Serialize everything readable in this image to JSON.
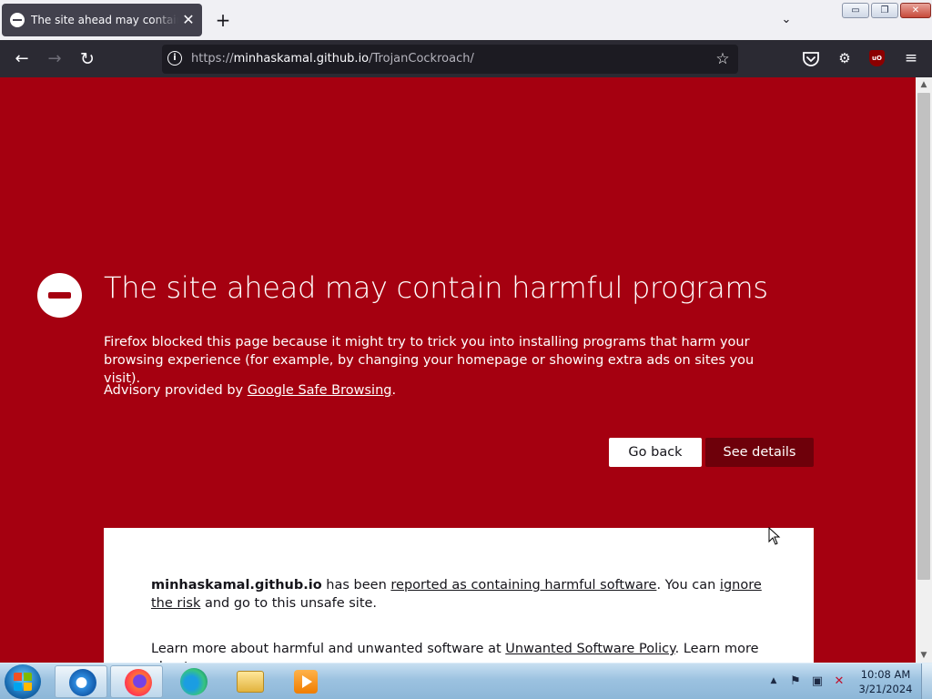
{
  "browser": {
    "tab": {
      "title": "The site ahead may contain harmful programs",
      "close_glyph": "✕",
      "icon": "blocked-icon"
    },
    "new_tab_glyph": "+",
    "tab_list_glyph": "⌄",
    "window_controls": {
      "minimize": "▭",
      "restore": "❐",
      "close": "✕"
    },
    "nav": {
      "back_glyph": "←",
      "forward_glyph": "→",
      "reload_glyph": "↻"
    },
    "url": {
      "scheme": "https://",
      "host": "minhaskamal.github.io",
      "path": "/TrojanCockroach/",
      "info_glyph": "i"
    },
    "bookmark_glyph": "☆",
    "toolbar": {
      "extensions_glyph": "⚙",
      "ublock_label": "uO",
      "menu_glyph": "≡"
    }
  },
  "page": {
    "title": "The site ahead may contain harmful programs",
    "description": "Firefox blocked this page because it might try to trick you into installing programs that harm your browsing experience (for example, by changing your homepage or showing extra ads on sites you visit).",
    "advisory_prefix": "Advisory provided by ",
    "advisory_link": "Google Safe Browsing",
    "advisory_suffix": ".",
    "buttons": {
      "go_back": "Go back",
      "see_details": "See details"
    },
    "details": {
      "site": "minhaskamal.github.io",
      "text1": " has been ",
      "link1": "reported as containing harmful software",
      "text2": ". You can ",
      "link2": "ignore the risk",
      "text3": " and go to this unsafe site.",
      "learn_prefix": "Learn more about harmful and unwanted software at ",
      "learn_link": "Unwanted Software Policy",
      "learn_suffix": ". Learn more about"
    }
  },
  "scrollbar": {
    "up_glyph": "▲",
    "down_glyph": "▼"
  },
  "taskbar": {
    "apps": [
      "internet-explorer",
      "firefox",
      "edge",
      "file-explorer",
      "media-player"
    ],
    "tray_expand_glyph": "▲",
    "tray": {
      "flag_glyph": "⚑",
      "network_glyph": "▣",
      "volume_glyph": "✕"
    },
    "clock": {
      "time": "10:08 AM",
      "date": "3/21/2024"
    }
  },
  "colors": {
    "page_background": "#a50010",
    "see_details_button": "#6e000a",
    "browser_toolbar": "#2b2a33",
    "url_field": "#1c1b22",
    "tab_active": "#42414d"
  }
}
